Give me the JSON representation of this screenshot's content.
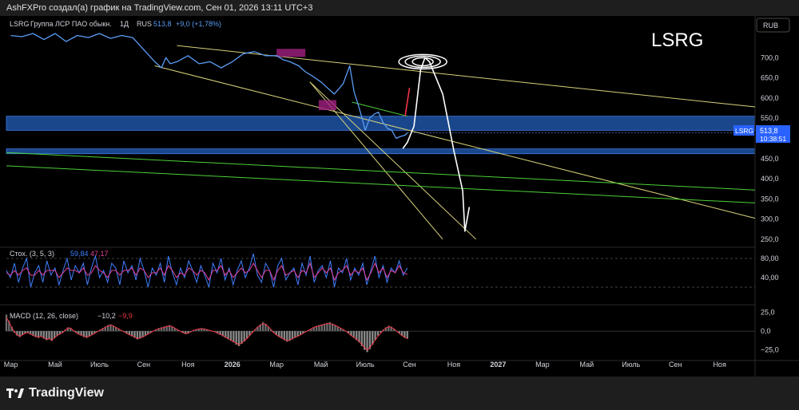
{
  "header": {
    "attribution": "AshFXPro создал(а) график на TradingView.com, Сен 01, 2026 13:11 UTC+3"
  },
  "footer": {
    "logo_text": "TradingView"
  },
  "chart_data": [
    {
      "type": "line",
      "pane": "price",
      "title": "LSRG",
      "legend": {
        "symbol": "LSRG",
        "name": "Группа ЛСР ПАО обыкн.",
        "interval": "1Д",
        "exchange": "RUS",
        "last": "513,8",
        "change": "+9,0 (+1,78%)"
      },
      "currency": "RUB",
      "ylim": [
        240,
        760
      ],
      "y_ticks": [
        "700,0",
        "650,0",
        "600,0",
        "550,0",
        "500,0",
        "450,0",
        "400,0",
        "350,0",
        "300,0",
        "250,0"
      ],
      "y_tick_values": [
        700,
        650,
        600,
        550,
        500,
        450,
        400,
        350,
        300,
        250
      ],
      "last_price_tag": {
        "symbol": "LSRG",
        "price": "513,8",
        "countdown": "10:38:51",
        "value": 513.8
      },
      "x_ticks": [
        "Мар",
        "Май",
        "Июль",
        "Сен",
        "Ноя",
        "2026",
        "Мар",
        "Май",
        "Июль",
        "Сен",
        "Ноя",
        "2027",
        "Мар",
        "Май",
        "Июль",
        "Сен",
        "Ноя"
      ],
      "x_tick_index": [
        0,
        2,
        4,
        6,
        8,
        10,
        12,
        14,
        16,
        18,
        20,
        22,
        24,
        26,
        28,
        30,
        32
      ],
      "x_range_months": [
        -0.2,
        33.6
      ],
      "x": [
        0,
        0.5,
        1,
        1.5,
        2,
        2.5,
        3,
        3.5,
        4,
        4.5,
        5,
        5.5,
        6,
        6.5,
        6.8,
        7,
        7.2,
        7.5,
        8,
        8.5,
        9,
        9.5,
        10,
        10.5,
        11,
        11.5,
        12,
        12.3,
        12.6,
        13,
        13.3,
        13.6,
        14,
        14.3,
        14.6,
        15,
        15.3,
        15.5,
        15.7,
        15.85,
        16,
        16.2,
        16.4,
        16.6,
        16.8,
        17,
        17.2,
        17.4,
        17.6,
        17.8,
        17.9
      ],
      "values": [
        755,
        752,
        760,
        745,
        760,
        740,
        755,
        750,
        760,
        748,
        755,
        750,
        720,
        690,
        675,
        700,
        685,
        690,
        705,
        685,
        690,
        675,
        690,
        710,
        715,
        705,
        705,
        695,
        690,
        680,
        665,
        655,
        640,
        625,
        610,
        635,
        680,
        615,
        580,
        552,
        520,
        550,
        560,
        565,
        540,
        525,
        520,
        500,
        505,
        508,
        513.8
      ],
      "zones": [
        {
          "from": 520,
          "to": 555,
          "color": "#1e53a5"
        },
        {
          "from": 462,
          "to": 474,
          "color": "#1e53a5"
        }
      ],
      "trendlines": [
        {
          "from": [
            7.5,
            730
          ],
          "to": [
            33.6,
            578
          ],
          "color": "#d8d27a"
        },
        {
          "from": [
            6.5,
            680
          ],
          "to": [
            33.6,
            302
          ],
          "color": "#d8d27a"
        },
        {
          "from": [
            13.5,
            640
          ],
          "to": [
            19.5,
            250
          ],
          "color": "#d8d27a"
        },
        {
          "from": [
            13.5,
            640
          ],
          "to": [
            21.0,
            250
          ],
          "color": "#d8d27a"
        },
        {
          "from": [
            -0.2,
            465
          ],
          "to": [
            33.6,
            372
          ],
          "color": "#4cd137"
        },
        {
          "from": [
            -0.2,
            432
          ],
          "to": [
            33.6,
            340
          ],
          "color": "#4cd137"
        },
        {
          "from": [
            15.4,
            590
          ],
          "to": [
            17.9,
            555
          ],
          "color": "#4cd137"
        }
      ],
      "highlight_boxes": [
        {
          "from": [
            13.9,
            595
          ],
          "to": [
            14.7,
            620
          ],
          "color": "#a0207f"
        },
        {
          "from": [
            12.0,
            722
          ],
          "to": [
            13.3,
            702
          ],
          "color": "#a0207f"
        }
      ],
      "annotations": [
        {
          "kind": "red-arrow",
          "points": [
            [
              17.8,
              555
            ],
            [
              18.0,
              625
            ]
          ]
        },
        {
          "kind": "white-drawing",
          "points": [
            [
              17.7,
              475
            ],
            [
              17.9,
              490
            ],
            [
              18.2,
              530
            ],
            [
              18.5,
              670
            ],
            [
              18.7,
              700
            ],
            [
              18.9,
              690
            ],
            [
              19.5,
              610
            ],
            [
              20.0,
              470
            ],
            [
              20.4,
              370
            ],
            [
              20.5,
              270
            ],
            [
              20.7,
              330
            ]
          ]
        }
      ]
    },
    {
      "type": "line",
      "pane": "stochastic",
      "legend": {
        "name": "Стох. (3, 5, 3)",
        "k": "59,84",
        "d": "47,17"
      },
      "ylim": [
        0,
        100
      ],
      "y_ticks": [
        "80,00",
        "40,00"
      ],
      "y_tick_values": [
        80,
        40
      ],
      "bands": [
        80,
        20
      ],
      "series": [
        {
          "name": "%K",
          "color": "#3f7fff",
          "values": [
            55,
            40,
            70,
            30,
            60,
            80,
            20,
            50,
            65,
            30,
            75,
            45,
            60,
            25,
            55,
            80,
            35,
            65,
            50,
            70,
            25,
            60,
            85,
            40,
            55,
            30,
            70,
            60,
            25,
            75,
            50,
            65,
            35,
            80,
            55,
            20,
            60,
            45,
            70,
            30,
            85,
            50,
            25,
            60,
            40,
            75,
            55,
            30,
            65,
            45,
            20,
            70,
            50,
            80,
            35,
            60,
            25,
            55,
            75,
            40,
            60,
            90,
            45,
            30,
            70,
            55,
            20,
            65,
            80,
            35,
            50,
            60,
            25,
            70,
            45,
            85,
            30,
            55,
            65,
            40,
            75,
            20,
            60,
            50,
            80,
            35,
            60,
            45,
            70,
            25,
            55,
            85,
            40,
            65,
            30,
            60,
            50,
            75,
            45,
            60
          ]
        },
        {
          "name": "%D",
          "color": "#e0409a",
          "values": [
            50,
            45,
            55,
            45,
            55,
            60,
            45,
            45,
            55,
            45,
            55,
            55,
            55,
            40,
            50,
            60,
            55,
            55,
            50,
            60,
            45,
            50,
            65,
            55,
            50,
            40,
            55,
            55,
            45,
            55,
            55,
            60,
            45,
            60,
            55,
            40,
            50,
            50,
            60,
            45,
            65,
            55,
            40,
            50,
            45,
            60,
            55,
            45,
            55,
            50,
            35,
            55,
            55,
            65,
            45,
            55,
            40,
            50,
            60,
            50,
            55,
            70,
            55,
            40,
            55,
            55,
            35,
            55,
            65,
            45,
            50,
            55,
            40,
            55,
            50,
            70,
            40,
            50,
            60,
            50,
            60,
            35,
            50,
            55,
            65,
            45,
            55,
            50,
            60,
            35,
            50,
            70,
            50,
            60,
            40,
            55,
            50,
            65,
            50,
            47.17
          ]
        }
      ],
      "end_month": 17.9
    },
    {
      "type": "bar",
      "pane": "macd",
      "legend": {
        "name": "MACD (12, 26, close)",
        "macd": "−10,2",
        "signal": "−9,9"
      },
      "ylim": [
        -35,
        32
      ],
      "y_ticks": [
        "25,0",
        "0,0",
        "−25,0"
      ],
      "y_tick_values": [
        25,
        0,
        -25
      ],
      "histogram": [
        22,
        14,
        6,
        -2,
        -6,
        -8,
        -5,
        -3,
        -2,
        -4,
        -6,
        -8,
        -9,
        -7,
        -10,
        -12,
        -11,
        -13,
        -9,
        -6,
        -4,
        -2,
        2,
        5,
        4,
        1,
        -2,
        -4,
        -6,
        -8,
        -9,
        -7,
        -5,
        -3,
        -1,
        2,
        4,
        6,
        8,
        9,
        7,
        5,
        3,
        1,
        -1,
        -3,
        -5,
        -7,
        -9,
        -11,
        -10,
        -8,
        -6,
        -4,
        -2,
        0,
        2,
        4,
        5,
        6,
        7,
        8,
        6,
        4,
        2,
        0,
        -2,
        -4,
        -3,
        -1,
        1,
        2,
        3,
        4,
        3,
        2,
        1,
        0,
        -1,
        -3,
        -5,
        -7,
        -9,
        -11,
        -13,
        -15,
        -18,
        -20,
        -17,
        -14,
        -10,
        -6,
        -2,
        2,
        6,
        9,
        12,
        10,
        6,
        2,
        -2,
        -5,
        -8,
        -10,
        -12,
        -14,
        -13,
        -11,
        -9,
        -7,
        -5,
        -3,
        -1,
        1,
        3,
        5,
        7,
        8,
        9,
        10,
        11,
        12,
        10,
        8,
        6,
        4,
        2,
        0,
        -3,
        -6,
        -9,
        -12,
        -15,
        -20,
        -25,
        -28,
        -24,
        -18,
        -12,
        -6,
        -2,
        2,
        5,
        7,
        6,
        3,
        0,
        -3,
        -6,
        -9,
        -10
      ],
      "macd_line": [
        18,
        12,
        5,
        -1,
        -5,
        -7,
        -5,
        -3,
        -2,
        -4,
        -6,
        -7,
        -8,
        -7,
        -9,
        -11,
        -10,
        -12,
        -9,
        -6,
        -4,
        -2,
        1,
        4,
        4,
        1,
        -2,
        -4,
        -5,
        -7,
        -8,
        -7,
        -5,
        -3,
        -1,
        1,
        3,
        5,
        7,
        8,
        7,
        5,
        3,
        1,
        -1,
        -3,
        -5,
        -6,
        -8,
        -10,
        -9,
        -8,
        -6,
        -4,
        -2,
        0,
        2,
        3,
        4,
        5,
        6,
        7,
        6,
        4,
        2,
        0,
        -2,
        -3,
        -3,
        -1,
        1,
        2,
        3,
        3,
        3,
        2,
        1,
        0,
        -1,
        -3,
        -4,
        -6,
        -8,
        -10,
        -12,
        -14,
        -16,
        -18,
        -16,
        -13,
        -10,
        -6,
        -2,
        2,
        5,
        8,
        10,
        9,
        6,
        2,
        -2,
        -5,
        -7,
        -9,
        -11,
        -13,
        -12,
        -10,
        -8,
        -7,
        -5,
        -3,
        -1,
        1,
        3,
        5,
        6,
        7,
        8,
        9,
        10,
        10,
        9,
        8,
        6,
        4,
        2,
        0,
        -3,
        -6,
        -8,
        -11,
        -14,
        -18,
        -22,
        -25,
        -22,
        -17,
        -12,
        -7,
        -3,
        1,
        4,
        6,
        5,
        3,
        0,
        -3,
        -6,
        -8,
        -10.2
      ],
      "end_month": 17.9
    }
  ]
}
